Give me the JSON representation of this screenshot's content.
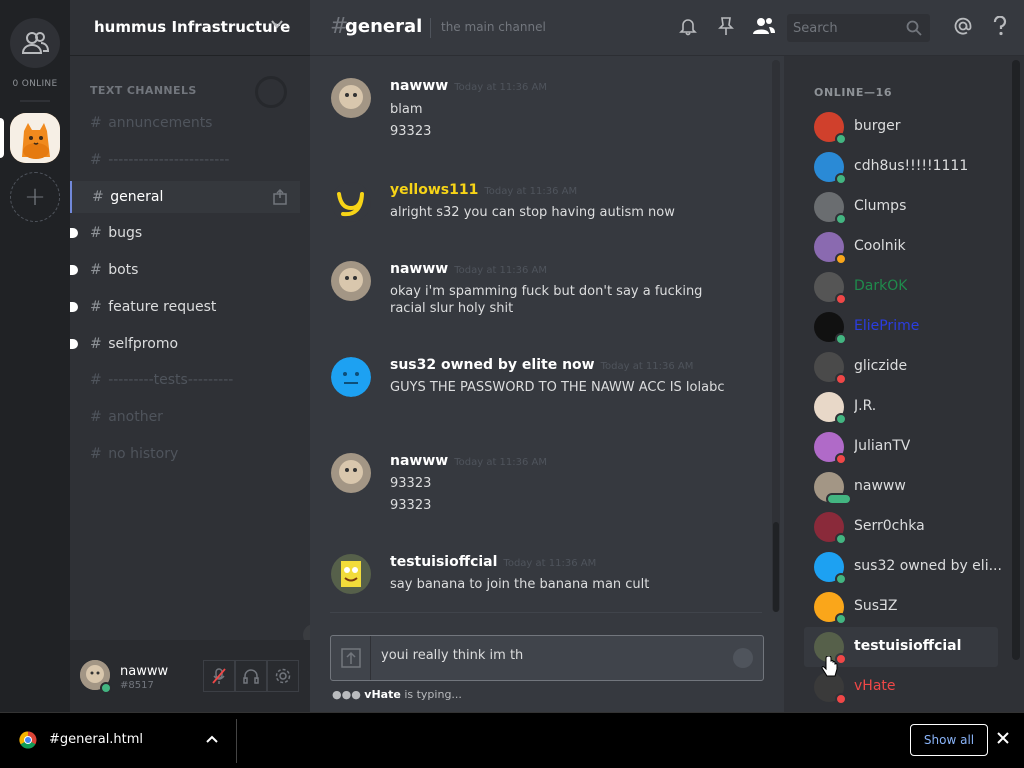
{
  "rail": {
    "online_count": "0 ONLINE",
    "add_label": "+"
  },
  "server": {
    "name": "hummus Infrastructure",
    "category": "TEXT CHANNELS"
  },
  "channels": [
    {
      "name": "annuncements"
    },
    {
      "name": "------------------------"
    },
    {
      "name": "general"
    },
    {
      "name": "bugs"
    },
    {
      "name": "bots"
    },
    {
      "name": "feature request"
    },
    {
      "name": "selfpromo"
    },
    {
      "name": "---------tests---------"
    },
    {
      "name": "another"
    },
    {
      "name": "no history"
    }
  ],
  "user": {
    "name": "nawww",
    "tag": "#8517"
  },
  "header": {
    "hash": "#",
    "channel": "general",
    "topic": "the main channel",
    "search_placeholder": "Search"
  },
  "messages": [
    {
      "author": "nawww",
      "time": "Today at 11:36 AM",
      "lines": [
        "blam",
        "93323"
      ]
    },
    {
      "author": "yellows111",
      "time": "Today at 11:36 AM",
      "lines": [
        "alright s32 you can stop having autism now"
      ]
    },
    {
      "author": "nawww",
      "time": "Today at 11:36 AM",
      "lines": [
        "okay i'm spamming fuck but don't say a fucking racial slur holy shit"
      ]
    },
    {
      "author": "sus32 owned by elite now",
      "time": "Today at 11:36 AM",
      "lines": [
        "GUYS THE PASSWORD TO THE NAWW ACC IS lolabc"
      ]
    },
    {
      "author": "nawww",
      "time": "Today at 11:36 AM",
      "lines": [
        "93323",
        "93323"
      ]
    },
    {
      "author": "testuisioffcial",
      "time": "Today at 11:36 AM",
      "lines": [
        "say banana to join the banana man cult"
      ]
    }
  ],
  "composer": {
    "text": "youi really think im th"
  },
  "typing": {
    "user": "vHate",
    "suffix": " is typing..."
  },
  "members": {
    "header": "ONLINE—16",
    "list": [
      {
        "name": "burger",
        "color": "#dcddde"
      },
      {
        "name": "cdh8us!!!!!1111",
        "color": "#dcddde"
      },
      {
        "name": "Clumps",
        "color": "#dcddde"
      },
      {
        "name": "Coolnik",
        "color": "#dcddde"
      },
      {
        "name": "DarkOK",
        "color": "#1f8b4c"
      },
      {
        "name": "EliePrime",
        "color": "#2b3de0"
      },
      {
        "name": "gliczide",
        "color": "#dcddde"
      },
      {
        "name": "J.R.",
        "color": "#dcddde"
      },
      {
        "name": "JulianTV",
        "color": "#dcddde"
      },
      {
        "name": "nawww",
        "color": "#dcddde"
      },
      {
        "name": "Serr0chka",
        "color": "#dcddde"
      },
      {
        "name": "sus32 owned by eli...",
        "color": "#dcddde"
      },
      {
        "name": "SusƎZ",
        "color": "#dcddde"
      },
      {
        "name": "testuisioffcial",
        "color": "#ffffff"
      },
      {
        "name": "vHate",
        "color": "#f04747"
      }
    ]
  },
  "download": {
    "filename": "#general.html",
    "show_all": "Show all"
  },
  "colors": {
    "blurple": "#7289da",
    "online": "#43b581",
    "idle": "#faa61a",
    "dnd": "#f04747",
    "yellow_name": "#f7d417"
  }
}
